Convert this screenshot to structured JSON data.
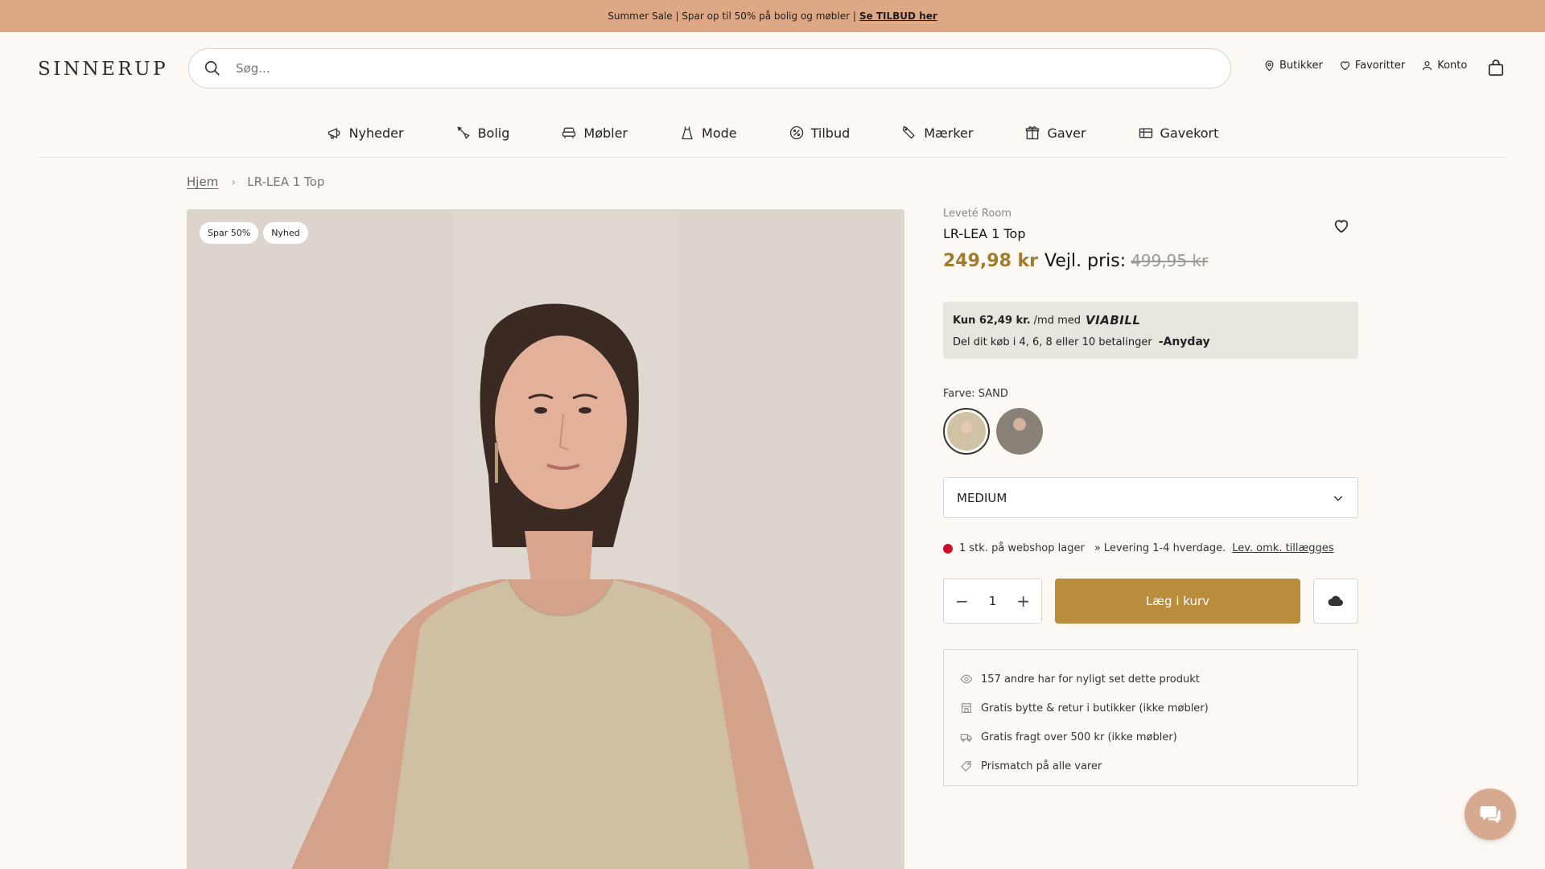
{
  "banner": {
    "text": "Summer Sale | Spar op til 50% på bolig og møbler |",
    "link": "Se TILBUD her"
  },
  "header": {
    "logo": "SINNERUP",
    "search_placeholder": "Søg...",
    "links": {
      "stores": "Butikker",
      "favorites": "Favoritter",
      "account": "Konto"
    }
  },
  "nav": {
    "items": [
      {
        "label": "Nyheder",
        "icon": "megaphone-icon"
      },
      {
        "label": "Bolig",
        "icon": "brush-icon"
      },
      {
        "label": "Møbler",
        "icon": "sofa-icon"
      },
      {
        "label": "Mode",
        "icon": "dress-icon"
      },
      {
        "label": "Tilbud",
        "icon": "percent-icon"
      },
      {
        "label": "Mærker",
        "icon": "tag-icon"
      },
      {
        "label": "Gaver",
        "icon": "gift-icon"
      },
      {
        "label": "Gavekort",
        "icon": "gift-card-icon"
      }
    ]
  },
  "breadcrumb": {
    "home": "Hjem",
    "current": "LR-LEA 1 Top"
  },
  "image": {
    "badges": [
      "Spar 50%",
      "Nyhed"
    ]
  },
  "product": {
    "brand": "Leveté Room",
    "title": "LR-LEA 1 Top",
    "price_now": "249,98 kr",
    "price_label": "Vejl. pris:",
    "price_old": "499,95 kr"
  },
  "finance": {
    "viabill_prefix": "Kun 62,49 kr.",
    "viabill_mid": "/md med",
    "viabill_brand": "VIABILL",
    "anyday_text": "Del dit køb i 4, 6, 8 eller 10 betalinger",
    "anyday_brand": "-Anyday"
  },
  "color": {
    "label": "Farve: SAND",
    "swatches": [
      {
        "name": "SAND",
        "hex": "#d2c2a5",
        "active": true
      },
      {
        "name": "GREY",
        "hex": "#8a8279",
        "active": false
      }
    ]
  },
  "size": {
    "selected": "MEDIUM"
  },
  "stock": {
    "status": "1 stk. på webshop lager",
    "delivery": "» Levering 1-4 hverdage.",
    "link": "Lev. omk. tillægges"
  },
  "buy": {
    "quantity": "1",
    "add_to_cart": "Læg i kurv"
  },
  "usps": [
    {
      "text": "157 andre har for nyligt set dette produkt",
      "icon": "eye-icon"
    },
    {
      "text": "Gratis bytte & retur i butikker (ikke møbler)",
      "icon": "store-icon"
    },
    {
      "text": "Gratis fragt over 500 kr (ikke møbler)",
      "icon": "truck-icon"
    },
    {
      "text": "Prismatch på alle varer",
      "icon": "price-tag-icon"
    }
  ],
  "colors": {
    "banner": "#dea887",
    "accent": "#b98d3c",
    "price": "#a47a2c",
    "stock_dot": "#c8102e"
  }
}
